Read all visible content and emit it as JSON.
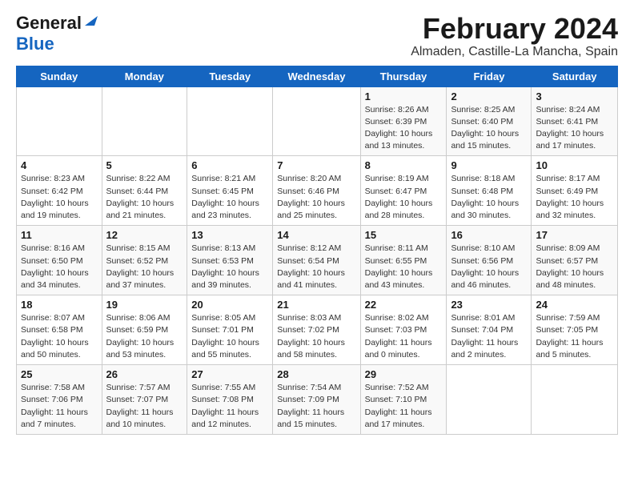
{
  "logo": {
    "line1": "General",
    "line2": "Blue"
  },
  "title": "February 2024",
  "subtitle": "Almaden, Castille-La Mancha, Spain",
  "days_of_week": [
    "Sunday",
    "Monday",
    "Tuesday",
    "Wednesday",
    "Thursday",
    "Friday",
    "Saturday"
  ],
  "weeks": [
    [
      {
        "day": "",
        "info": ""
      },
      {
        "day": "",
        "info": ""
      },
      {
        "day": "",
        "info": ""
      },
      {
        "day": "",
        "info": ""
      },
      {
        "day": "1",
        "info": "Sunrise: 8:26 AM\nSunset: 6:39 PM\nDaylight: 10 hours\nand 13 minutes."
      },
      {
        "day": "2",
        "info": "Sunrise: 8:25 AM\nSunset: 6:40 PM\nDaylight: 10 hours\nand 15 minutes."
      },
      {
        "day": "3",
        "info": "Sunrise: 8:24 AM\nSunset: 6:41 PM\nDaylight: 10 hours\nand 17 minutes."
      }
    ],
    [
      {
        "day": "4",
        "info": "Sunrise: 8:23 AM\nSunset: 6:42 PM\nDaylight: 10 hours\nand 19 minutes."
      },
      {
        "day": "5",
        "info": "Sunrise: 8:22 AM\nSunset: 6:44 PM\nDaylight: 10 hours\nand 21 minutes."
      },
      {
        "day": "6",
        "info": "Sunrise: 8:21 AM\nSunset: 6:45 PM\nDaylight: 10 hours\nand 23 minutes."
      },
      {
        "day": "7",
        "info": "Sunrise: 8:20 AM\nSunset: 6:46 PM\nDaylight: 10 hours\nand 25 minutes."
      },
      {
        "day": "8",
        "info": "Sunrise: 8:19 AM\nSunset: 6:47 PM\nDaylight: 10 hours\nand 28 minutes."
      },
      {
        "day": "9",
        "info": "Sunrise: 8:18 AM\nSunset: 6:48 PM\nDaylight: 10 hours\nand 30 minutes."
      },
      {
        "day": "10",
        "info": "Sunrise: 8:17 AM\nSunset: 6:49 PM\nDaylight: 10 hours\nand 32 minutes."
      }
    ],
    [
      {
        "day": "11",
        "info": "Sunrise: 8:16 AM\nSunset: 6:50 PM\nDaylight: 10 hours\nand 34 minutes."
      },
      {
        "day": "12",
        "info": "Sunrise: 8:15 AM\nSunset: 6:52 PM\nDaylight: 10 hours\nand 37 minutes."
      },
      {
        "day": "13",
        "info": "Sunrise: 8:13 AM\nSunset: 6:53 PM\nDaylight: 10 hours\nand 39 minutes."
      },
      {
        "day": "14",
        "info": "Sunrise: 8:12 AM\nSunset: 6:54 PM\nDaylight: 10 hours\nand 41 minutes."
      },
      {
        "day": "15",
        "info": "Sunrise: 8:11 AM\nSunset: 6:55 PM\nDaylight: 10 hours\nand 43 minutes."
      },
      {
        "day": "16",
        "info": "Sunrise: 8:10 AM\nSunset: 6:56 PM\nDaylight: 10 hours\nand 46 minutes."
      },
      {
        "day": "17",
        "info": "Sunrise: 8:09 AM\nSunset: 6:57 PM\nDaylight: 10 hours\nand 48 minutes."
      }
    ],
    [
      {
        "day": "18",
        "info": "Sunrise: 8:07 AM\nSunset: 6:58 PM\nDaylight: 10 hours\nand 50 minutes."
      },
      {
        "day": "19",
        "info": "Sunrise: 8:06 AM\nSunset: 6:59 PM\nDaylight: 10 hours\nand 53 minutes."
      },
      {
        "day": "20",
        "info": "Sunrise: 8:05 AM\nSunset: 7:01 PM\nDaylight: 10 hours\nand 55 minutes."
      },
      {
        "day": "21",
        "info": "Sunrise: 8:03 AM\nSunset: 7:02 PM\nDaylight: 10 hours\nand 58 minutes."
      },
      {
        "day": "22",
        "info": "Sunrise: 8:02 AM\nSunset: 7:03 PM\nDaylight: 11 hours\nand 0 minutes."
      },
      {
        "day": "23",
        "info": "Sunrise: 8:01 AM\nSunset: 7:04 PM\nDaylight: 11 hours\nand 2 minutes."
      },
      {
        "day": "24",
        "info": "Sunrise: 7:59 AM\nSunset: 7:05 PM\nDaylight: 11 hours\nand 5 minutes."
      }
    ],
    [
      {
        "day": "25",
        "info": "Sunrise: 7:58 AM\nSunset: 7:06 PM\nDaylight: 11 hours\nand 7 minutes."
      },
      {
        "day": "26",
        "info": "Sunrise: 7:57 AM\nSunset: 7:07 PM\nDaylight: 11 hours\nand 10 minutes."
      },
      {
        "day": "27",
        "info": "Sunrise: 7:55 AM\nSunset: 7:08 PM\nDaylight: 11 hours\nand 12 minutes."
      },
      {
        "day": "28",
        "info": "Sunrise: 7:54 AM\nSunset: 7:09 PM\nDaylight: 11 hours\nand 15 minutes."
      },
      {
        "day": "29",
        "info": "Sunrise: 7:52 AM\nSunset: 7:10 PM\nDaylight: 11 hours\nand 17 minutes."
      },
      {
        "day": "",
        "info": ""
      },
      {
        "day": "",
        "info": ""
      }
    ]
  ]
}
